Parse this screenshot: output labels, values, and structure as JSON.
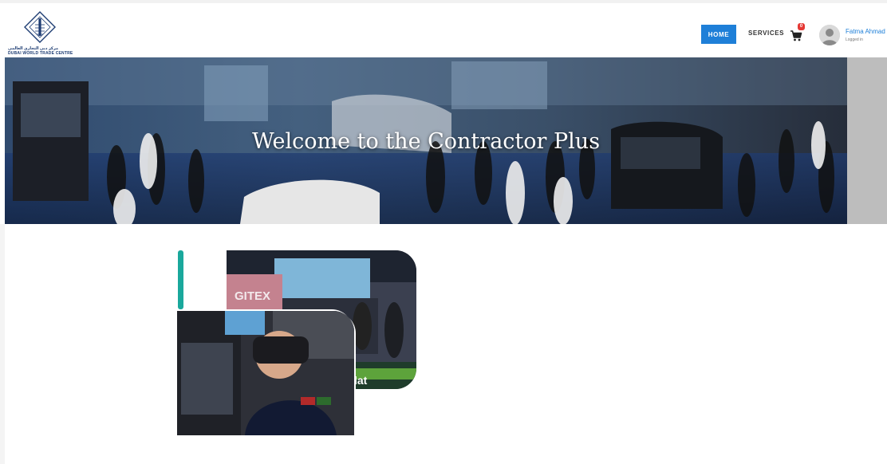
{
  "brand": {
    "logo_arabic": "مركز دبي التجاري العالمي",
    "logo_english": "DUBAI WORLD TRADE CENTRE"
  },
  "nav": {
    "home": "HOME",
    "services": "SERVICES",
    "cart_count": "0",
    "accent_color": "#1e7fd8"
  },
  "user": {
    "name": "Fatma Ahmad",
    "status": "Logged in"
  },
  "hero": {
    "title": "Welcome to the Contractor Plus"
  },
  "feature": {
    "accent_color": "#1aa89c",
    "photo_sign_1": "GITEX",
    "photo_sign_2": "lat"
  },
  "icons": [
    "dwtc-logo-icon",
    "cart-icon",
    "user-avatar-icon"
  ]
}
